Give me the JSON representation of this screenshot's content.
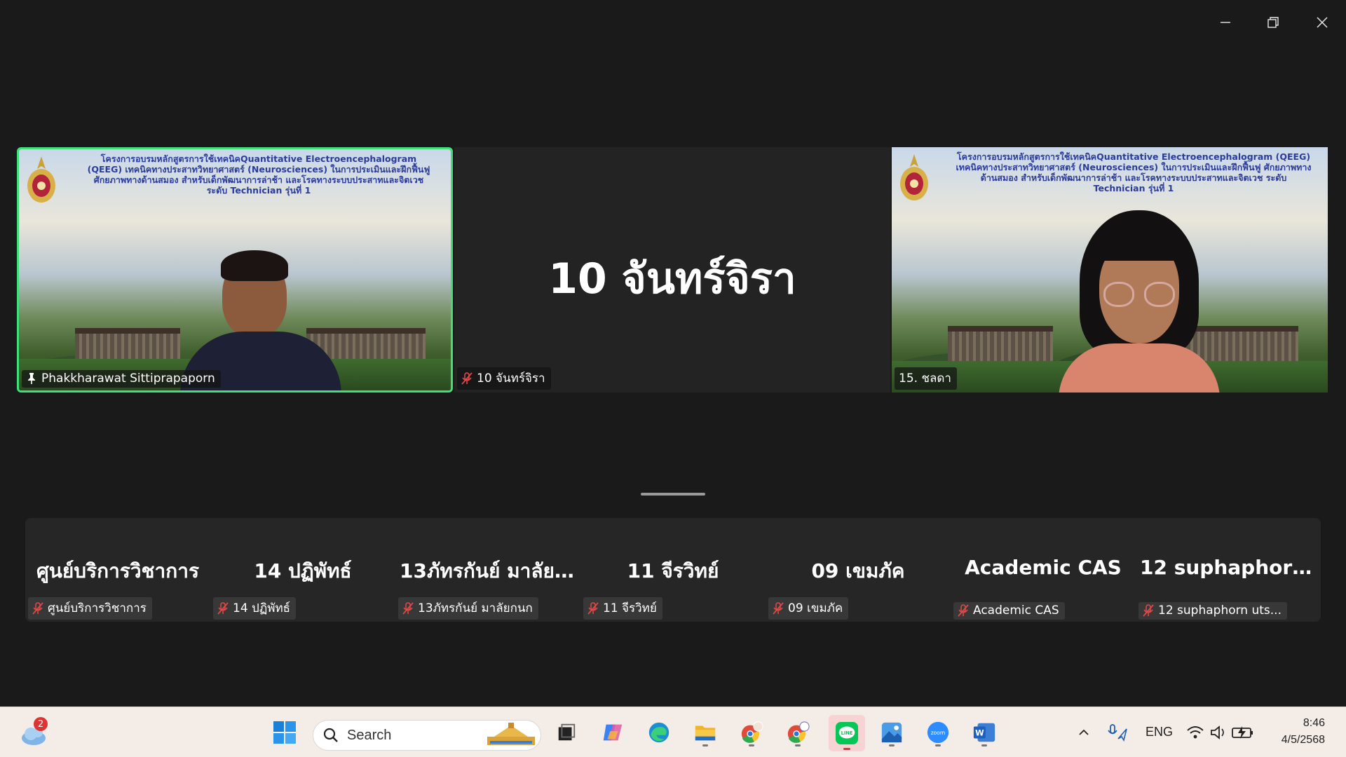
{
  "window": {
    "minimize_icon": "minimize-icon",
    "restore_icon": "restore-icon",
    "close_icon": "close-icon"
  },
  "tiles": [
    {
      "name": "Phakkharawat Sittiprapaporn",
      "pinned": true,
      "active_speaker": true,
      "background_header": "โครงการอบรมหลักสูตรการใช้เทคนิคQuantitative Electroencephalogram (QEEG) เทคนิคทางประสาทวิทยาศาสตร์ (Neurosciences) ในการประเมินและฝึกฟื้นฟู ศักยภาพทางด้านสมอง สำหรับเด็กพัฒนาการล่าช้า และโรคทางระบบประสาทและจิตเวช ระดับ Technician รุ่นที่ 1"
    },
    {
      "name": "10 จันทร์จิรา",
      "display_name": "10 จันทร์จิรา",
      "muted": true
    },
    {
      "name": "15. ชลดา",
      "muted": false,
      "background_header": "โครงการอบรมหลักสูตรการใช้เทคนิคQuantitative Electroencephalogram (QEEG) เทคนิคทางประสาทวิทยาศาสตร์ (Neurosciences) ในการประเมินและฝึกฟื้นฟู ศักยภาพทางด้านสมอง สำหรับเด็กพัฒนาการล่าช้า และโรคทางระบบประสาทและจิตเวช ระดับ Technician รุ่นที่ 1"
    }
  ],
  "participants": [
    {
      "display": "ศูนย์บริการวิชาการ",
      "label": "ศูนย์บริการวิชาการ",
      "muted": true
    },
    {
      "display": "14 ปฏิพัทธ์",
      "label": "14 ปฏิพัทธ์",
      "muted": true
    },
    {
      "display": "13ภัทรกันย์ มาลัย...",
      "label": "13ภัทรกันย์ มาลัยกนก",
      "muted": true
    },
    {
      "display": "11 จีรวิทย์",
      "label": "11 จีรวิทย์",
      "muted": true
    },
    {
      "display": "09 เขมภัค",
      "label": "09 เขมภัค",
      "muted": true
    },
    {
      "display": "Academic CAS",
      "label": "Academic CAS",
      "muted": true
    },
    {
      "display": "12  suphaphorn...",
      "label": "12 suphaphorn uts...",
      "muted": true
    }
  ],
  "taskbar": {
    "weather_badge": "2",
    "search_placeholder": "Search",
    "apps": [
      "start-icon",
      "task-view-icon",
      "copilot-icon",
      "edge-icon",
      "file-explorer-icon",
      "chrome-profile-icon",
      "chrome-cas-icon",
      "line-icon",
      "photos-icon",
      "zoom-icon",
      "word-icon"
    ],
    "language": "ENG",
    "time": "8:46",
    "date": "4/5/2568"
  },
  "colors": {
    "active_speaker_border": "#3ee07a",
    "muted_icon": "#e04848",
    "line_green": "#06c755",
    "zoom_blue": "#2d8cff"
  }
}
